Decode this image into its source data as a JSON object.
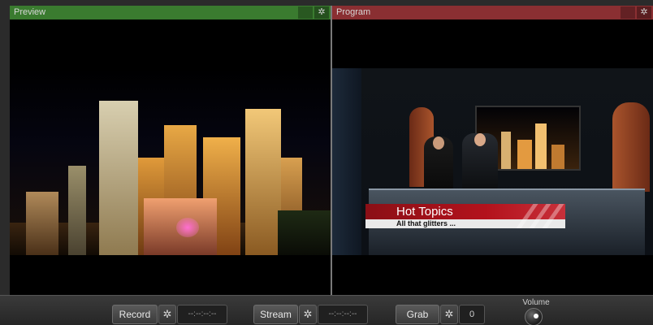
{
  "preview": {
    "title": "Preview",
    "config_icon": "gear-icon"
  },
  "program": {
    "title": "Program",
    "config_icon": "gear-icon",
    "lower_third": {
      "title": "Hot Topics",
      "subtitle": "All that glitters ..."
    }
  },
  "controls": {
    "record": {
      "label": "Record",
      "timecode": "--:--:--:--",
      "config_icon": "gear-icon"
    },
    "stream": {
      "label": "Stream",
      "timecode": "--:--:--:--",
      "config_icon": "gear-icon"
    },
    "grab": {
      "label": "Grab",
      "count": "0",
      "config_icon": "gear-icon"
    },
    "volume": {
      "label": "Volume"
    }
  },
  "colors": {
    "preview_header": "#3a7b2f",
    "program_header": "#8a2f32",
    "lower_third": "#b3121c"
  }
}
